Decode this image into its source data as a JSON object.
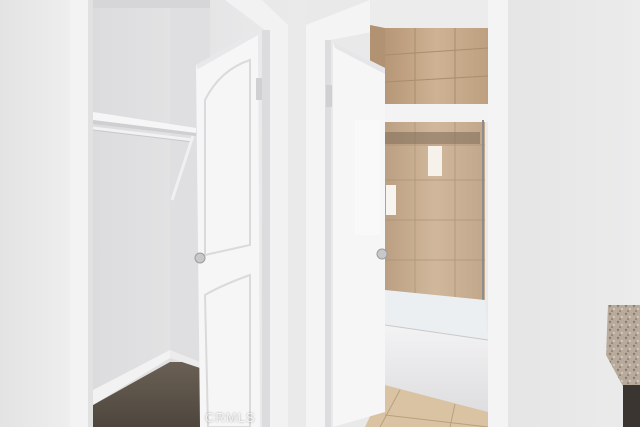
{
  "photo": {
    "subject": "hallway",
    "watermark": "CRMLS"
  },
  "colors": {
    "wall": "#e6e6e7",
    "trim": "#f4f4f4",
    "door": "#f6f6f7",
    "carpet": "#5e554b",
    "tile": "#c8ab8a",
    "floor_tile": "#d9c3a3",
    "granite": "#b8aa9a"
  }
}
